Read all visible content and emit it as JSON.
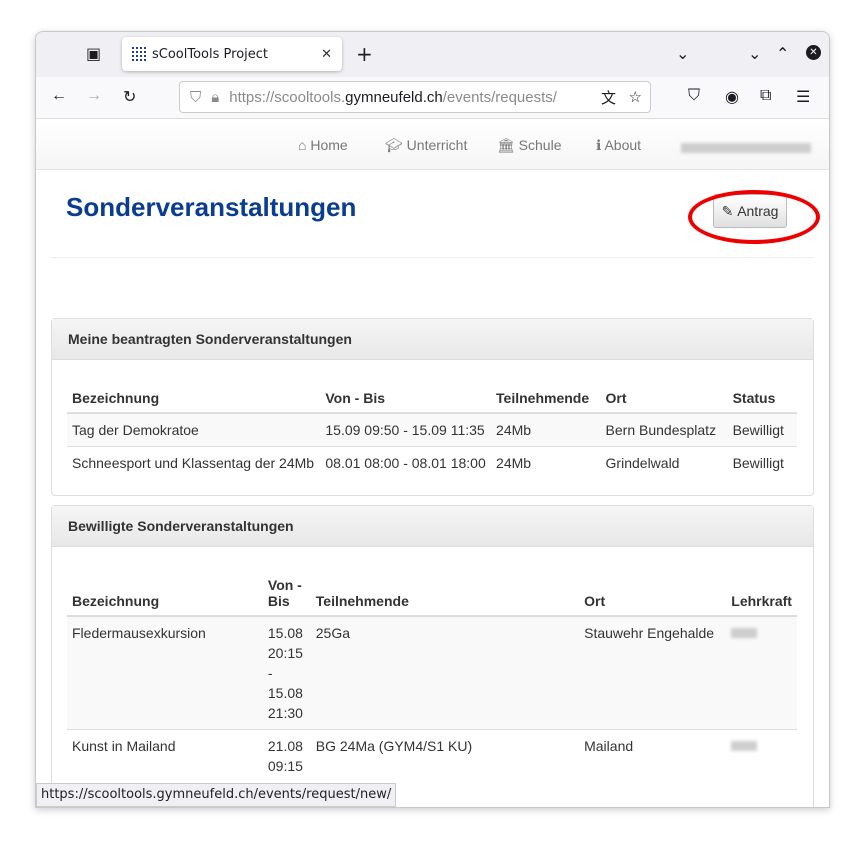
{
  "browser": {
    "tab_title": "sCoolTools Project",
    "url_prefix": "https://scooltools.",
    "url_host": "gymneufeld.ch",
    "url_path": "/events/requests/",
    "status_url": "https://scooltools.gymneufeld.ch/events/request/new/"
  },
  "nav": {
    "items": [
      {
        "label": "Home",
        "icon": "home-icon"
      },
      {
        "label": "Unterricht",
        "icon": "graduation-cap-icon"
      },
      {
        "label": "Schule",
        "icon": "school-icon"
      },
      {
        "label": "About",
        "icon": "info-icon"
      }
    ]
  },
  "page": {
    "title": "Sonderveranstaltungen",
    "antrag_label": "Antrag"
  },
  "panel1": {
    "title": "Meine beantragten Sonderveranstaltungen",
    "headers": [
      "Bezeichnung",
      "Von - Bis",
      "Teilnehmende",
      "Ort",
      "Status"
    ],
    "rows": [
      [
        "Tag der Demokratoe",
        "15.09 09:50 - 15.09 11:35",
        "24Mb",
        "Bern Bundesplatz",
        "Bewilligt"
      ],
      [
        "Schneesport und Klassentag der 24Mb",
        "08.01 08:00 - 08.01 18:00",
        "24Mb",
        "Grindelwald",
        "Bewilligt"
      ]
    ]
  },
  "panel2": {
    "title": "Bewilligte Sonderveranstaltungen",
    "headers": [
      "Bezeichnung",
      "Von - Bis",
      "Teilnehmende",
      "Ort",
      "Lehrkraft"
    ],
    "rows": [
      [
        "Fledermausexkursion",
        "15.08 20:15 - 15.08 21:30",
        "25Ga",
        "Stauwehr Engehalde"
      ],
      [
        "Kunst in Mailand",
        "21.08 09:15",
        "BG 24Ma (GYM4/S1 KU)",
        "Mailand"
      ]
    ]
  }
}
